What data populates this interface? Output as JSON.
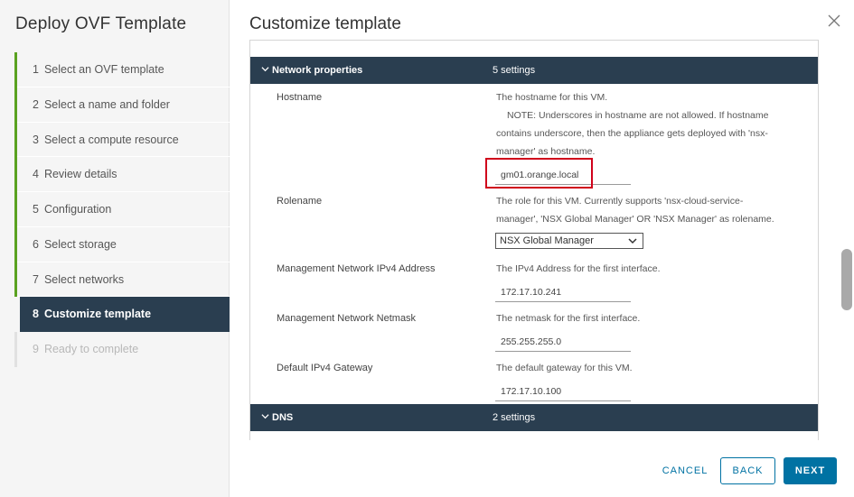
{
  "wizard": {
    "title": "Deploy OVF Template",
    "steps": [
      {
        "num": "1",
        "label": "Select an OVF template"
      },
      {
        "num": "2",
        "label": "Select a name and folder"
      },
      {
        "num": "3",
        "label": "Select a compute resource"
      },
      {
        "num": "4",
        "label": "Review details"
      },
      {
        "num": "5",
        "label": "Configuration"
      },
      {
        "num": "6",
        "label": "Select storage"
      },
      {
        "num": "7",
        "label": "Select networks"
      },
      {
        "num": "8",
        "label": "Customize template"
      },
      {
        "num": "9",
        "label": "Ready to complete"
      }
    ]
  },
  "page": {
    "title": "Customize template",
    "close_icon": "close-icon"
  },
  "sections": {
    "network": {
      "name": "Network properties",
      "count": "5 settings"
    },
    "dns": {
      "name": "DNS",
      "count": "2 settings"
    }
  },
  "fields": {
    "hostname": {
      "label": "Hostname",
      "desc_line1": "The hostname for this VM.",
      "desc_line2": "NOTE: Underscores in hostname are not allowed.  If hostname",
      "desc_line3": "contains underscore, then the appliance gets deployed with 'nsx-",
      "desc_line4": "manager' as hostname.",
      "value": "gm01.orange.local"
    },
    "rolename": {
      "label": "Rolename",
      "desc_line1": "The role for this VM. Currently supports 'nsx-cloud-service-",
      "desc_line2": "manager', 'NSX Global Manager' OR 'NSX Manager' as rolename.",
      "value": "NSX Global Manager"
    },
    "mgmt_ip": {
      "label": "Management Network IPv4 Address",
      "desc": "The IPv4 Address for the first interface.",
      "value": "172.17.10.241"
    },
    "mgmt_netmask": {
      "label": "Management Network Netmask",
      "desc": "The netmask for the first interface.",
      "value": "255.255.255.0"
    },
    "gateway": {
      "label": "Default IPv4 Gateway",
      "desc": "The default gateway for this VM.",
      "value": "172.17.10.100"
    }
  },
  "footer": {
    "cancel": "CANCEL",
    "back": "BACK",
    "next": "NEXT"
  },
  "colors": {
    "accent": "#0072a3",
    "header_dark": "#2a3e50",
    "step_complete": "#5aa220",
    "highlight": "#d0021b"
  }
}
